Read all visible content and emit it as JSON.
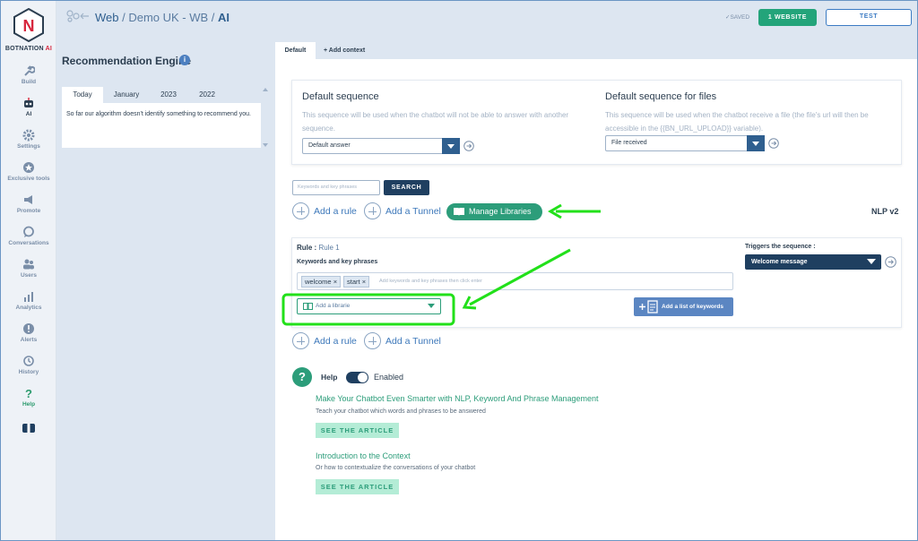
{
  "brand": {
    "name_a": "BOTNATION",
    "name_b": " AI",
    "logo_letter": "N"
  },
  "nav": [
    {
      "label": "Build",
      "icon": "wrench-icon"
    },
    {
      "label": "AI",
      "icon": "robot-icon"
    },
    {
      "label": "Settings",
      "icon": "gear-icon"
    },
    {
      "label": "Exclusive tools",
      "icon": "star-icon"
    },
    {
      "label": "Promote",
      "icon": "megaphone-icon"
    },
    {
      "label": "Conversations",
      "icon": "chat-icon"
    },
    {
      "label": "Users",
      "icon": "users-icon"
    },
    {
      "label": "Analytics",
      "icon": "chart-icon"
    },
    {
      "label": "Alerts",
      "icon": "alert-icon"
    },
    {
      "label": "History",
      "icon": "history-icon"
    },
    {
      "label": "Help",
      "icon": "question-icon"
    }
  ],
  "header": {
    "crumb_a": "Web",
    "sep1": " / ",
    "crumb_b": "Demo UK - WB",
    "sep2": " / ",
    "crumb_c": "AI",
    "saved": "SAVED",
    "website_btn": "1 WEBSITE",
    "test_btn": "TEST"
  },
  "recommendation": {
    "title": "Recommendation Engine",
    "info": "i",
    "tabs": [
      "Today",
      "January",
      "2023",
      "2022"
    ],
    "active_tab": "Today",
    "message": "So far our algorithm doesn't identify something to recommend you."
  },
  "context_tabs": {
    "default": "Default",
    "add": "+ Add context"
  },
  "default_sequence": {
    "title": "Default sequence",
    "description": "This sequence will be used when the chatbot will not be able to answer with another sequence.",
    "value": "Default answer"
  },
  "file_sequence": {
    "title": "Default sequence for files",
    "description": "This sequence will be used when the chatbot receive a file (the file's url will then be accessible in the {{BN_URL_UPLOAD}} variable).",
    "value": "File received"
  },
  "search": {
    "placeholder": "Keywords and key phrases",
    "button": "SEARCH"
  },
  "actions": {
    "add_rule": "Add a rule",
    "add_tunnel": "Add a Tunnel",
    "manage_libraries": "Manage Libraries",
    "nlp": "NLP v2"
  },
  "rule": {
    "label": "Rule :",
    "name": "Rule 1",
    "keywords_label": "Keywords and key phrases",
    "tags": [
      "welcome",
      "start"
    ],
    "tag_remove": "×",
    "keywords_placeholder": "Add keywords and key phrases then click enter",
    "library_placeholder": "Add a librarie",
    "list_button": "Add a list of keywords",
    "triggers_label": "Triggers the sequence :",
    "trigger_value": "Welcome message"
  },
  "help": {
    "badge": "?",
    "label": "Help",
    "enabled": "Enabled",
    "articles": [
      {
        "title": "Make Your Chatbot Even Smarter with NLP, Keyword And Phrase Management",
        "desc": "Teach your chatbot which words and phrases to be answered",
        "button": "SEE THE ARTICLE"
      },
      {
        "title": "Introduction to the Context",
        "desc": "Or how to contextualize the conversations of your chatbot",
        "button": "SEE THE ARTICLE"
      }
    ]
  },
  "colors": {
    "accent": "#2c9d7a",
    "navy": "#1f3f60",
    "link": "#3d78ba",
    "annotation": "#22e01a"
  }
}
